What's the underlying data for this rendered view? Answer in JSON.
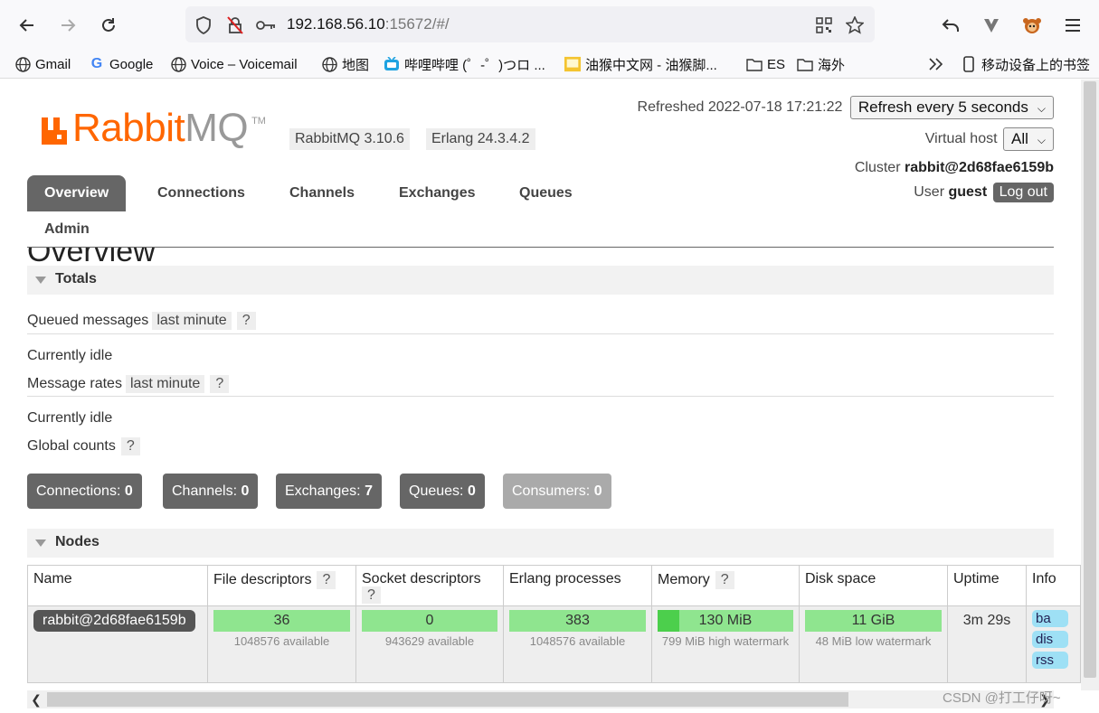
{
  "browser": {
    "url_host": "192.168.56.10",
    "url_rest": ":15672/#/",
    "bookmarks": [
      "Gmail",
      "Google",
      "Voice – Voicemail",
      "地图",
      "哔哩哔哩 (゜-゜)つロ ...",
      "油猴中文网 - 油猴脚...",
      "ES",
      "海外"
    ],
    "mobile_bookmarks": "移动设备上的书签"
  },
  "header": {
    "logo_rabbit": "Rabbit",
    "logo_mq": "MQ",
    "logo_tm": "TM",
    "rabbitmq_version": "RabbitMQ 3.10.6",
    "erlang_version": "Erlang 24.3.4.2",
    "refreshed": "Refreshed 2022-07-18 17:21:22",
    "refresh_select": "Refresh every 5 seconds",
    "vhost_label": "Virtual host",
    "vhost_select": "All",
    "cluster_label": "Cluster",
    "cluster_name": "rabbit@2d68fae6159b",
    "user_label": "User",
    "user_name": "guest",
    "logout": "Log out"
  },
  "tabs": [
    "Overview",
    "Connections",
    "Channels",
    "Exchanges",
    "Queues",
    "Admin"
  ],
  "overview": {
    "title": "Overview",
    "totals_title": "Totals",
    "queued_label": "Queued messages",
    "queued_tag": "last minute",
    "help": "?",
    "queued_status": "Currently idle",
    "rates_label": "Message rates",
    "rates_tag": "last minute",
    "rates_status": "Currently idle",
    "global_label": "Global counts"
  },
  "counters": [
    {
      "label": "Connections:",
      "value": "0"
    },
    {
      "label": "Channels:",
      "value": "0"
    },
    {
      "label": "Exchanges:",
      "value": "7"
    },
    {
      "label": "Queues:",
      "value": "0"
    },
    {
      "label": "Consumers:",
      "value": "0"
    }
  ],
  "nodes": {
    "title": "Nodes",
    "columns": [
      "Name",
      "File descriptors",
      "Socket descriptors",
      "Erlang processes",
      "Memory",
      "Disk space",
      "Uptime",
      "Info"
    ],
    "row": {
      "name": "rabbit@2d68fae6159b",
      "fd": "36",
      "fd_sub": "1048576 available",
      "sd": "0",
      "sd_sub": "943629 available",
      "ep": "383",
      "ep_sub": "1048576 available",
      "mem": "130 MiB",
      "mem_sub": "799 MiB high watermark",
      "mem_fraction": 0.16,
      "disk": "11 GiB",
      "disk_sub": "48 MiB low watermark",
      "uptime": "3m 29s",
      "info": [
        "ba",
        "dis",
        "rss"
      ]
    }
  },
  "watermark": "CSDN @打工仔呀~"
}
